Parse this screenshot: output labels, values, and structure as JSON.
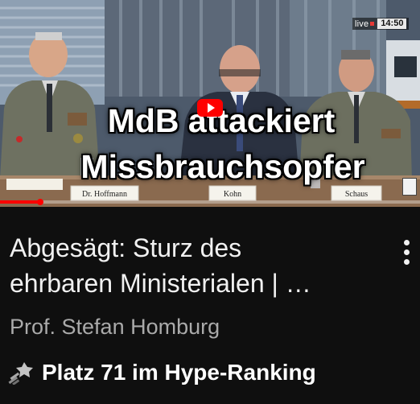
{
  "video": {
    "thumbnail": {
      "overlay_line1": "MdB attackiert",
      "overlay_line2": "Missbrauchsopfer",
      "live_label": "live",
      "live_time": "14:50",
      "nameplates": [
        "Dr. Hoffmann",
        "Kohn",
        "Schaus"
      ],
      "progress_fraction": 0.095,
      "play_icon": "youtube-play-icon"
    },
    "title_line1": "Abgesägt: Sturz des",
    "title_line2": "ehrbaren Ministerialen | …",
    "channel": "Prof. Stefan Homburg",
    "hype_badge": {
      "icon": "hype-rocket-icon",
      "text": "Platz 71 im Hype-Ranking"
    },
    "menu_icon": "more-vertical-icon"
  },
  "colors": {
    "background": "#0f0f0f",
    "title": "#f1f1f1",
    "channel": "#aaaaaa",
    "accent_red": "#ff0000"
  }
}
